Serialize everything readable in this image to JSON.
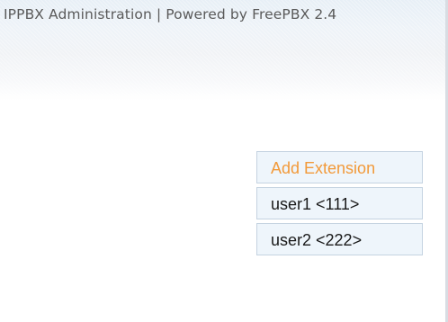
{
  "header": {
    "title": "IPPBX Administration | Powered by FreePBX 2.4"
  },
  "extensions": {
    "add_label": "Add Extension",
    "items": [
      {
        "label": "user1 <111>"
      },
      {
        "label": "user2 <222>"
      }
    ]
  },
  "colors": {
    "add_link": "#f29a3a",
    "item_bg": "#eef5fb",
    "item_border": "#c5d3e1"
  }
}
